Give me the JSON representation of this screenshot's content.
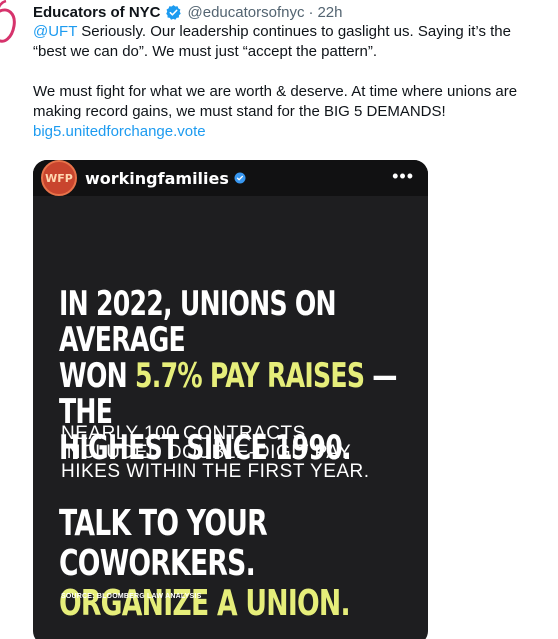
{
  "tweet": {
    "display_name": "Educators of NYC",
    "handle": "@educatorsofnyc",
    "separator": "·",
    "time": "22h",
    "mention": "@UFT",
    "line1_rest": " Seriously. Our leadership continues to gaslight us. Saying it’s the",
    "line2": "“best we can do”. We must just “accept the pattern”.",
    "para2_line1": "We must fight for what we are worth & deserve. At time where unions are",
    "para2_line2": "making record gains, we must stand for the BIG 5 DEMANDS!",
    "link": "big5.unitedforchange.vote"
  },
  "media": {
    "account_name": "workingfamilies",
    "avatar_text": "WFP",
    "more": "•••",
    "headline_1": "IN 2022, UNIONS ON AVERAGE",
    "headline_2a": "WON ",
    "headline_2b": "5.7% PAY RAISES",
    "headline_2c": " — THE",
    "headline_3": "HIGHEST SINCE 1990.",
    "sub_1": "NEARLY 100 CONTRACTS",
    "sub_2": "INCLUDED DOUBLE-DIGIT PAY",
    "sub_3": "HIKES WITHIN THE FIRST YEAR.",
    "cta_1": "TALK TO YOUR COWORKERS.",
    "cta_2": "ORGANIZE A UNION.",
    "source": "SOURCE: BLOOMBERG LAW ANALYSIS"
  },
  "colors": {
    "link": "#1d9bf0",
    "highlight": "#e6ee7a",
    "verified": "#1d9bf0",
    "media_bg": "#1e1e20"
  }
}
